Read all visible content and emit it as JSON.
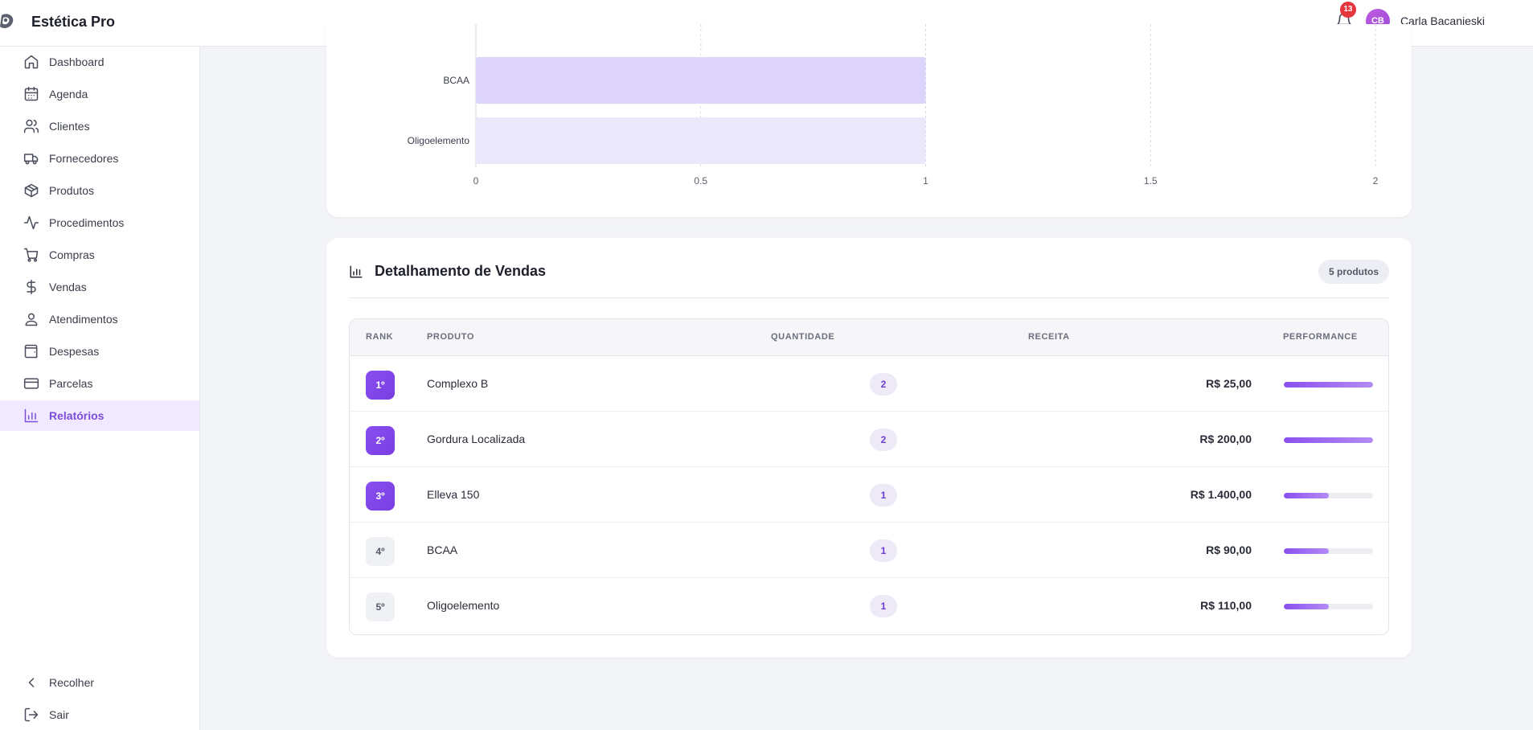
{
  "app": {
    "name": "Estética Pro"
  },
  "header": {
    "notifications_count": "13",
    "user_initials": "CB",
    "user_name": "Carla Bacanieski"
  },
  "sidebar": {
    "items": [
      {
        "label": "Dashboard",
        "icon": "home-icon"
      },
      {
        "label": "Agenda",
        "icon": "calendar-icon"
      },
      {
        "label": "Clientes",
        "icon": "users-icon"
      },
      {
        "label": "Fornecedores",
        "icon": "truck-icon"
      },
      {
        "label": "Produtos",
        "icon": "package-icon"
      },
      {
        "label": "Procedimentos",
        "icon": "activity-icon"
      },
      {
        "label": "Compras",
        "icon": "cart-icon"
      },
      {
        "label": "Vendas",
        "icon": "dollar-icon"
      },
      {
        "label": "Atendimentos",
        "icon": "user-pin-icon"
      },
      {
        "label": "Despesas",
        "icon": "wallet-icon"
      },
      {
        "label": "Parcelas",
        "icon": "credit-card-icon"
      },
      {
        "label": "Relatórios",
        "icon": "bar-chart-icon",
        "active": true
      }
    ],
    "collapse_label": "Recolher",
    "logout_label": "Sair"
  },
  "chart_data": {
    "type": "bar",
    "orientation": "horizontal",
    "categories": [
      "BCAA",
      "Oligoelemento"
    ],
    "values": [
      1,
      1
    ],
    "xlim": [
      0,
      2
    ],
    "x_ticks": [
      "0",
      "0.5",
      "1",
      "1.5",
      "2"
    ],
    "grid": true,
    "colors": [
      "#dcd4fb",
      "#ece8fb"
    ]
  },
  "detail": {
    "title": "Detalhamento de Vendas",
    "count_label": "5 produtos",
    "columns": {
      "rank": "RANK",
      "product": "PRODUTO",
      "quantity": "QUANTIDADE",
      "revenue": "RECEITA",
      "performance": "PERFORMANCE"
    },
    "rows": [
      {
        "rank": "1º",
        "product": "Complexo B",
        "quantity": "2",
        "revenue": "R$ 25,00",
        "performance": 1.0
      },
      {
        "rank": "2º",
        "product": "Gordura Localizada",
        "quantity": "2",
        "revenue": "R$ 200,00",
        "performance": 1.0
      },
      {
        "rank": "3º",
        "product": "Elleva 150",
        "quantity": "1",
        "revenue": "R$ 1.400,00",
        "performance": 0.5
      },
      {
        "rank": "4º",
        "product": "BCAA",
        "quantity": "1",
        "revenue": "R$ 90,00",
        "performance": 0.5
      },
      {
        "rank": "5º",
        "product": "Oligoelemento",
        "quantity": "1",
        "revenue": "R$ 110,00",
        "performance": 0.5
      }
    ]
  },
  "colors": {
    "accent": "#7c4ddc",
    "accent_light": "#f0e9ff",
    "badge_red": "#e5353d"
  }
}
